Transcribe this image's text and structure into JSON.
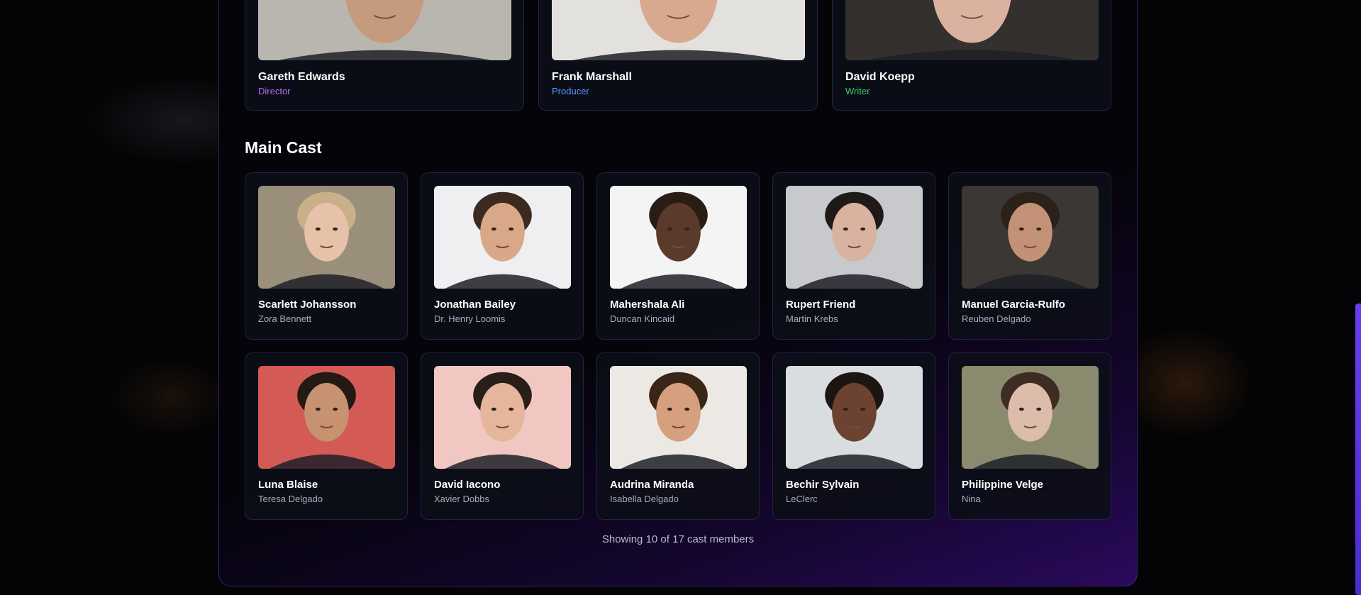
{
  "crew": [
    {
      "name": "Gareth Edwards",
      "role": "Director",
      "role_color": "#b56cf0",
      "bg": "#b9b6b0",
      "skin": "#c69a7c",
      "hair": "#5a4030"
    },
    {
      "name": "Frank Marshall",
      "role": "Producer",
      "role_color": "#4f9bff",
      "bg": "#e3e1de",
      "skin": "#d8a98e",
      "hair": "#c9c3bb"
    },
    {
      "name": "David Koepp",
      "role": "Writer",
      "role_color": "#34d06a",
      "bg": "#33302d",
      "skin": "#d9b3a0",
      "hair": "#d6d1ca"
    }
  ],
  "main_cast": {
    "title": "Main Cast",
    "members": [
      {
        "name": "Scarlett Johansson",
        "character": "Zora Bennett",
        "bg": "#9a8f7a",
        "skin": "#e6c2a8",
        "hair": "#c9b08a"
      },
      {
        "name": "Jonathan Bailey",
        "character": "Dr. Henry Loomis",
        "bg": "#efeef0",
        "skin": "#d8a888",
        "hair": "#3b2a1f"
      },
      {
        "name": "Mahershala Ali",
        "character": "Duncan Kincaid",
        "bg": "#f4f4f4",
        "skin": "#5a3a2a",
        "hair": "#2a1d16"
      },
      {
        "name": "Rupert Friend",
        "character": "Martin Krebs",
        "bg": "#c7c9cc",
        "skin": "#d9b2a0",
        "hair": "#1e1a18"
      },
      {
        "name": "Manuel Garcia-Rulfo",
        "character": "Reuben Delgado",
        "bg": "#3a3734",
        "skin": "#c39276",
        "hair": "#2b201a"
      },
      {
        "name": "Luna Blaise",
        "character": "Teresa Delgado",
        "bg": "#d45a56",
        "skin": "#c6926f",
        "hair": "#231915"
      },
      {
        "name": "David Iacono",
        "character": "Xavier Dobbs",
        "bg": "#f1c7c2",
        "skin": "#e5b59c",
        "hair": "#2a1e18"
      },
      {
        "name": "Audrina Miranda",
        "character": "Isabella Delgado",
        "bg": "#ece9e4",
        "skin": "#d6a07f",
        "hair": "#3a2616"
      },
      {
        "name": "Bechir Sylvain",
        "character": "LeClerc",
        "bg": "#d9dde0",
        "skin": "#6b4330",
        "hair": "#1d1512"
      },
      {
        "name": "Philippine Velge",
        "character": "Nina",
        "bg": "#8a8a6f",
        "skin": "#dcbcaa",
        "hair": "#3e2c22"
      }
    ]
  },
  "footer": {
    "count_text": "Showing 10 of 17 cast members"
  }
}
